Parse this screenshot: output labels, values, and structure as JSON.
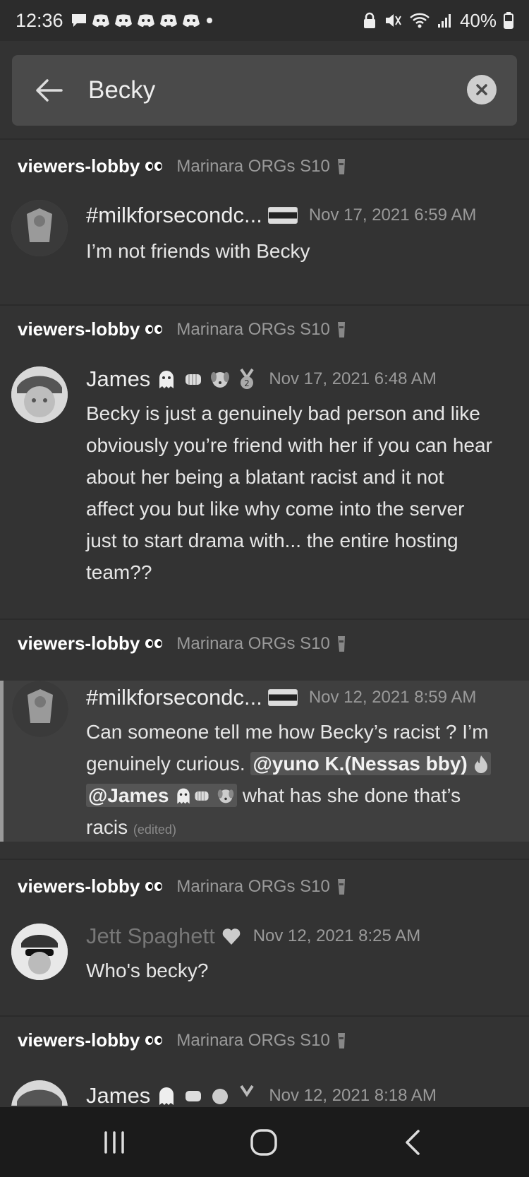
{
  "status": {
    "time": "12:36",
    "battery": "40%"
  },
  "search": {
    "query": "Becky"
  },
  "results": [
    {
      "channel": "viewers-lobby",
      "guild": "Marinara ORGs S10",
      "author": "#milkforsecondc...",
      "time": "Nov 17, 2021 6:59 AM",
      "text": "I’m not friends with Becky"
    },
    {
      "channel": "viewers-lobby",
      "guild": "Marinara ORGs S10",
      "author": "James",
      "time": "Nov 17, 2021 6:48 AM",
      "lines": [
        "Becky is just a genuinely bad person and like",
        "obviously you’re friend with her if you can hear",
        "about her being a blatant racist and it not",
        "affect you but like why come into the server",
        "just to start drama with... the entire hosting",
        "team??"
      ]
    },
    {
      "channel": "viewers-lobby",
      "guild": "Marinara ORGs S10",
      "author": "#milkforsecondc...",
      "time": "Nov 12, 2021 8:59 AM",
      "line1": "Can someone tell me how Becky’s racist ? I’m",
      "line2_pre": "genuinely curious. ",
      "mention1": "@yuno K.(Nessas bby)",
      "mention2": "@James",
      "line3_post": " what has she done that’s",
      "line4": "racis",
      "edited": "(edited)"
    },
    {
      "channel": "viewers-lobby",
      "guild": "Marinara ORGs S10",
      "author": "Jett Spaghett",
      "time": "Nov 12, 2021 8:25 AM",
      "text": "Who's becky?"
    },
    {
      "channel": "viewers-lobby",
      "guild": "Marinara ORGs S10",
      "author": "James",
      "time": "Nov 12, 2021 8:18 AM"
    }
  ]
}
